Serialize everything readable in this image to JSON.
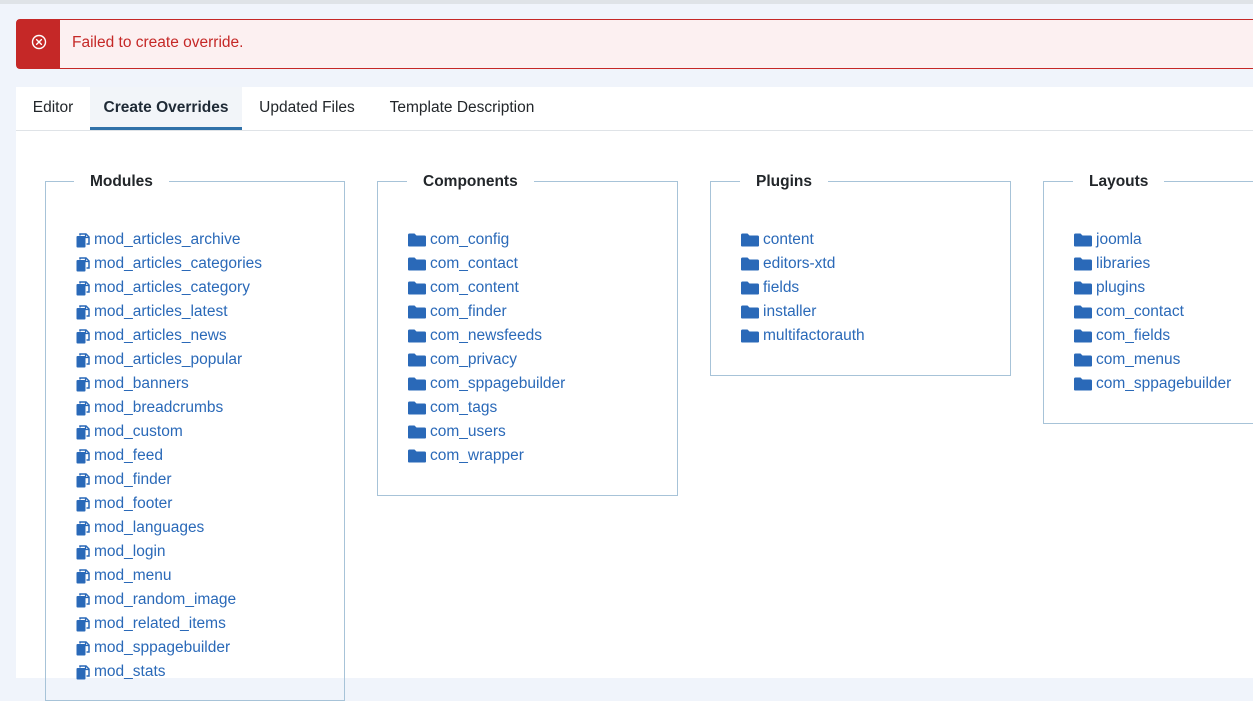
{
  "alert": {
    "message": "Failed to create override."
  },
  "tabs": [
    {
      "label": "Editor"
    },
    {
      "label": "Create Overrides"
    },
    {
      "label": "Updated Files"
    },
    {
      "label": "Template Description"
    }
  ],
  "groups": {
    "modules": {
      "title": "Modules",
      "items": [
        "mod_articles_archive",
        "mod_articles_categories",
        "mod_articles_category",
        "mod_articles_latest",
        "mod_articles_news",
        "mod_articles_popular",
        "mod_banners",
        "mod_breadcrumbs",
        "mod_custom",
        "mod_feed",
        "mod_finder",
        "mod_footer",
        "mod_languages",
        "mod_login",
        "mod_menu",
        "mod_random_image",
        "mod_related_items",
        "mod_sppagebuilder",
        "mod_stats"
      ]
    },
    "components": {
      "title": "Components",
      "items": [
        "com_config",
        "com_contact",
        "com_content",
        "com_finder",
        "com_newsfeeds",
        "com_privacy",
        "com_sppagebuilder",
        "com_tags",
        "com_users",
        "com_wrapper"
      ]
    },
    "plugins": {
      "title": "Plugins",
      "items": [
        "content",
        "editors-xtd",
        "fields",
        "installer",
        "multifactorauth"
      ]
    },
    "layouts": {
      "title": "Layouts",
      "items": [
        "joomla",
        "libraries",
        "plugins",
        "com_contact",
        "com_fields",
        "com_menus",
        "com_sppagebuilder"
      ]
    }
  },
  "colors": {
    "link": "#2a69b8",
    "danger": "#c52827",
    "fieldset_border": "#a7c3d8",
    "active_tab": "#3071a9"
  },
  "icons": {
    "module_item": "copy-icon",
    "folder_item": "folder-icon",
    "alert": "circle-x-icon"
  }
}
